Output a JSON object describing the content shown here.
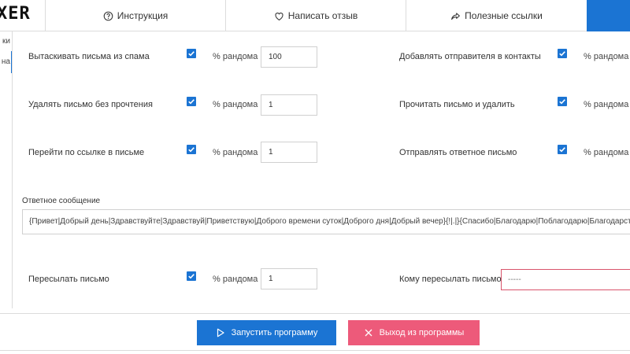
{
  "header": {
    "logo_text": "XER",
    "tabs": [
      {
        "label": "Инструкция",
        "icon": "question-circle-icon"
      },
      {
        "label": "Написать отзыв",
        "icon": "heart-icon"
      },
      {
        "label": "Полезные ссылки",
        "icon": "share-arrow-icon"
      }
    ],
    "accent_color": "#1b74d3"
  },
  "sidebar": {
    "items": [
      {
        "label": "ки"
      },
      {
        "label": "на"
      }
    ]
  },
  "options": {
    "random_label": "% рандома",
    "left": [
      {
        "label": "Вытаскивать письма из спама",
        "checked": true,
        "random_value": "100"
      },
      {
        "label": "Удалять письмо без прочтения",
        "checked": true,
        "random_value": "1"
      },
      {
        "label": "Перейти по ссылке в письме",
        "checked": true,
        "random_value": "1"
      }
    ],
    "right": [
      {
        "label": "Добавлять отправителя в контакты",
        "checked": true
      },
      {
        "label": "Прочитать письмо и удалить",
        "checked": true
      },
      {
        "label": "Отправлять ответное письмо",
        "checked": true
      }
    ]
  },
  "reply": {
    "label": "Ответное сообщение",
    "value": "{Привет|Добрый день|Здравствуйте|Здравствуй|Приветствую|Доброго времени суток|Доброго дня|Добрый вечер}{!|.|}{Спасибо|Благодарю|Поблагодарю|Благодарствую"
  },
  "forward": {
    "label": "Пересылать письмо",
    "checked": true,
    "random_value": "1",
    "to_label": "Кому пересылать письмо",
    "to_placeholder": "-----"
  },
  "footer": {
    "run_label": "Запустить программу",
    "exit_label": "Выход из программы",
    "run_color": "#1b74d3",
    "exit_color": "#ed5a7a"
  }
}
